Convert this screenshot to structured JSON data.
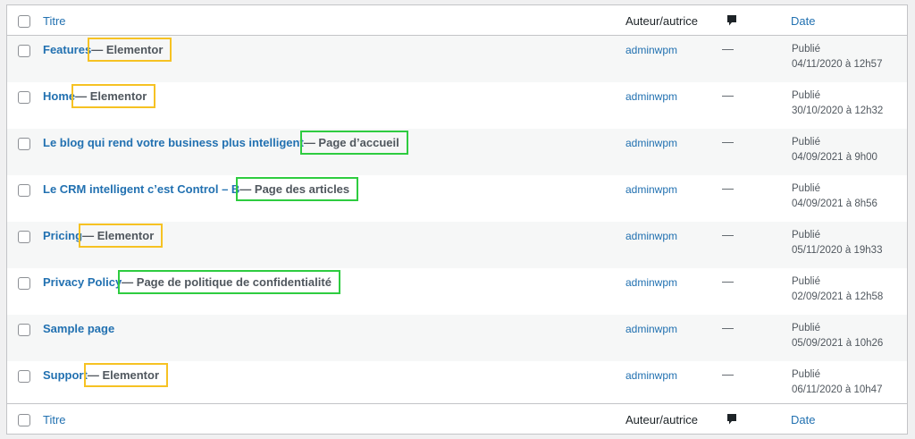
{
  "header": {
    "title_label": "Titre",
    "author_label": "Auteur/autrice",
    "comments_icon": "comment-bubble-icon",
    "date_label": "Date"
  },
  "rows": [
    {
      "title": "Features",
      "state": "— Elementor",
      "highlight": "yellow",
      "author": "adminwpm",
      "comments": "—",
      "status": "Publié",
      "date": "04/11/2020 à 12h57"
    },
    {
      "title": "Home",
      "state": "— Elementor",
      "highlight": "yellow",
      "author": "adminwpm",
      "comments": "—",
      "status": "Publié",
      "date": "30/10/2020 à 12h32"
    },
    {
      "title": "Le blog qui rend votre business plus intelligent",
      "state": "— Page d’accueil",
      "highlight": "green",
      "author": "adminwpm",
      "comments": "—",
      "status": "Publié",
      "date": "04/09/2021 à 9h00"
    },
    {
      "title": "Le CRM intelligent c’est Control – B",
      "state": "— Page des articles",
      "highlight": "green",
      "author": "adminwpm",
      "comments": "—",
      "status": "Publié",
      "date": "04/09/2021 à 8h56"
    },
    {
      "title": "Pricing",
      "state": "— Elementor",
      "highlight": "yellow",
      "author": "adminwpm",
      "comments": "—",
      "status": "Publié",
      "date": "05/11/2020 à 19h33"
    },
    {
      "title": "Privacy Policy",
      "state": "— Page de politique de confidentialité",
      "highlight": "green",
      "author": "adminwpm",
      "comments": "—",
      "status": "Publié",
      "date": "02/09/2021 à 12h58"
    },
    {
      "title": "Sample page",
      "state": "",
      "highlight": "",
      "author": "adminwpm",
      "comments": "—",
      "status": "Publié",
      "date": "05/09/2021 à 10h26"
    },
    {
      "title": "Support",
      "state": "— Elementor",
      "highlight": "yellow",
      "author": "adminwpm",
      "comments": "—",
      "status": "Publié",
      "date": "06/11/2020 à 10h47"
    }
  ],
  "colors": {
    "link": "#2271b1",
    "highlight_yellow": "#f6c223",
    "highlight_green": "#2ecc40",
    "row_alt": "#f6f7f7"
  }
}
